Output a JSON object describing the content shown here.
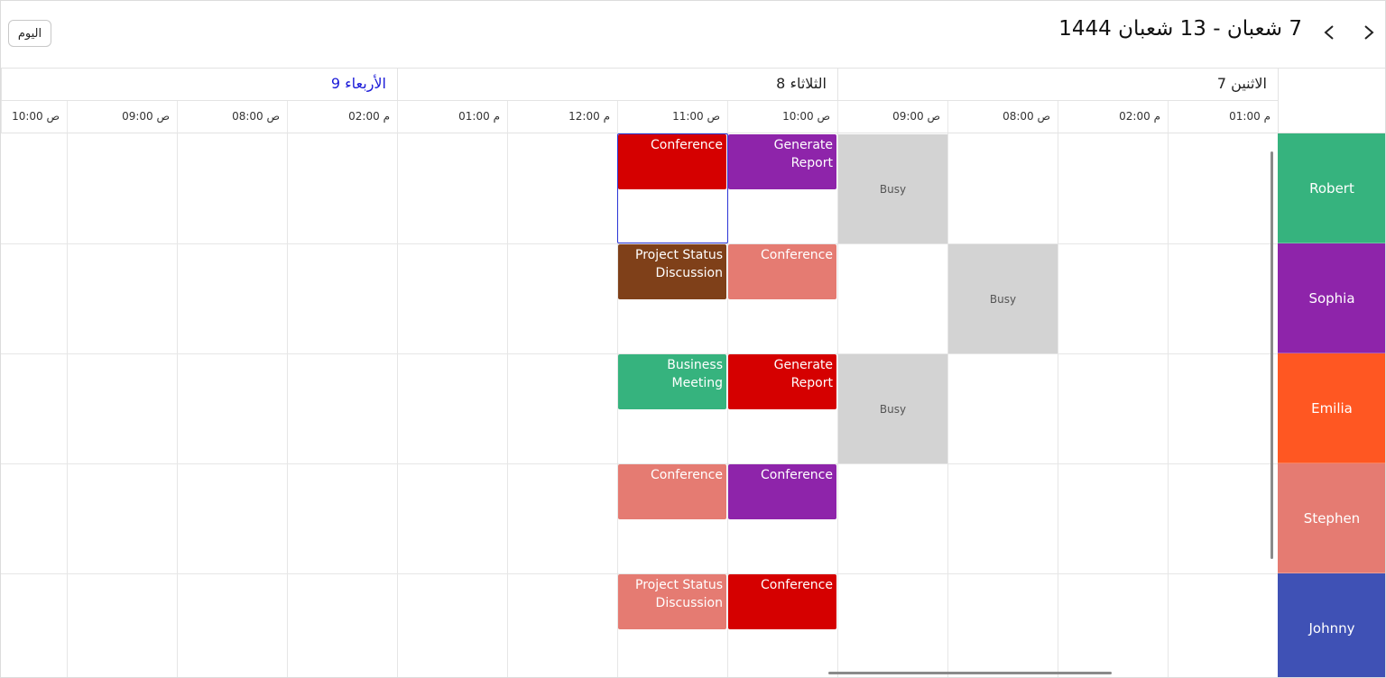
{
  "header": {
    "title": "7 شعبان - 13 شعبان 1444",
    "today_label": "اليوم"
  },
  "days": [
    {
      "label": "الاثنين 7",
      "today": false
    },
    {
      "label": "الثلاثاء 8",
      "today": false
    },
    {
      "label": "الأربعاء 9",
      "today": true
    }
  ],
  "time_slots": [
    "م 01:00",
    "م 02:00",
    "ص 08:00",
    "ص 09:00",
    "ص 10:00",
    "ص 11:00",
    "م 12:00",
    "م 01:00",
    "م 02:00",
    "ص 08:00",
    "ص 09:00",
    "ص 10:00"
  ],
  "resources": [
    {
      "name": "Robert",
      "color": "#36b37e"
    },
    {
      "name": "Sophia",
      "color": "#8e24aa"
    },
    {
      "name": "Emilia",
      "color": "#ff5722"
    },
    {
      "name": "Stephen",
      "color": "#e57b72"
    },
    {
      "name": "Johnny",
      "color": "#3f51b5"
    }
  ],
  "busy_blocks": [
    {
      "resource": 0,
      "slot": 3,
      "label": "Busy"
    },
    {
      "resource": 1,
      "slot": 2,
      "label": "Busy"
    },
    {
      "resource": 2,
      "slot": 3,
      "label": "Busy"
    }
  ],
  "appointments": [
    {
      "resource": 0,
      "slot": 4,
      "title": "Generate Report",
      "color": "#8e24aa"
    },
    {
      "resource": 0,
      "slot": 5,
      "title": "Conference",
      "color": "#d50000"
    },
    {
      "resource": 1,
      "slot": 4,
      "title": "Conference",
      "color": "#e57b72"
    },
    {
      "resource": 1,
      "slot": 5,
      "title": "Project Status Discussion",
      "color": "#7f4019"
    },
    {
      "resource": 2,
      "slot": 4,
      "title": "Generate Report",
      "color": "#d50000"
    },
    {
      "resource": 2,
      "slot": 5,
      "title": "Business Meeting",
      "color": "#36b37e"
    },
    {
      "resource": 3,
      "slot": 4,
      "title": "Conference",
      "color": "#8e24aa"
    },
    {
      "resource": 3,
      "slot": 5,
      "title": "Conference",
      "color": "#e57b72"
    },
    {
      "resource": 4,
      "slot": 4,
      "title": "Conference",
      "color": "#d50000"
    },
    {
      "resource": 4,
      "slot": 5,
      "title": "Project Status Discussion",
      "color": "#e57b72"
    }
  ],
  "selected_cell": {
    "resource": 0,
    "slot": 5
  }
}
